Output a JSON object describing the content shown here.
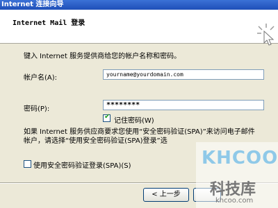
{
  "window": {
    "title": "Internet 连接向导"
  },
  "header": {
    "title": "Internet Mail 登录",
    "icon": "wizard-icon"
  },
  "intro": "键入 Internet 服务提供商给您的帐户名称和密码。",
  "username": {
    "label": "帐户名(A):",
    "value": "yourname@yourdomain.com"
  },
  "password": {
    "label": "密码(P):",
    "value": "********"
  },
  "remember": {
    "label": "记住密码(W)",
    "checked": true
  },
  "spa_note": "如果 Internet 服务供应商要求您使用“安全密码验证(SPA)”来访问电子邮件帐户，请选择“使用安全密码验证(SPA)登录”选",
  "spa": {
    "label": "使用安全密码验证登录(SPA)(S)",
    "checked": false
  },
  "buttons": {
    "back": "< 上一步"
  },
  "watermark": {
    "logo": "KHCOO",
    "name": "科技库",
    "url": "khcoo.com"
  },
  "colors": {
    "title_bar": "#245edb",
    "dialog_bg": "#ece9d8",
    "field_border": "#7f9db9"
  }
}
